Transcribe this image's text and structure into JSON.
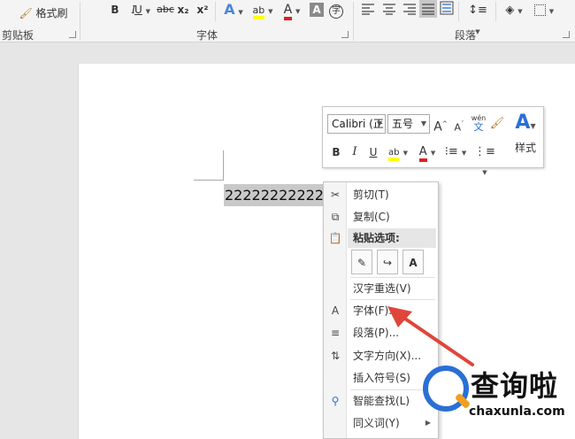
{
  "ribbon": {
    "clipboard": {
      "format_painter_label": "格式刷",
      "group_label": "剪贴板"
    },
    "font": {
      "bold": "B",
      "italic": "I",
      "underline": "U",
      "strikethrough": "abc",
      "subscript": "x₂",
      "superscript": "x²",
      "text_effect": "A",
      "highlight": "ab",
      "font_color": "A",
      "char_shading": "A",
      "enclose": "字",
      "group_label": "字体"
    },
    "paragraph": {
      "group_label": "段落"
    }
  },
  "document": {
    "selected_text": "2222222222222"
  },
  "mini_toolbar": {
    "font_name": "Calibri (正",
    "font_size": "五号",
    "grow": "A",
    "shrink": "A",
    "phonetic_top": "wén",
    "phonetic_bottom": "文",
    "styles_label": "样式",
    "bold": "B",
    "italic": "I",
    "underline": "U",
    "highlight": "ab",
    "font_color": "A"
  },
  "context_menu": {
    "cut": "剪切(T)",
    "copy": "复制(C)",
    "paste_options": "粘贴选项:",
    "hanzi_reselect": "汉字重选(V)",
    "font": "字体(F)...",
    "paragraph": "段落(P)...",
    "text_direction": "文字方向(X)...",
    "insert_symbol": "插入符号(S)",
    "smart_lookup": "智能查找(L)",
    "synonyms": "同义词(Y)"
  },
  "watermark": {
    "title": "查询啦",
    "url": "chaxunla.com"
  },
  "colors": {
    "highlight_yellow": "#ffff00",
    "font_red": "#e02020",
    "accent_blue": "#2a6fd6",
    "arrow_red": "#e0453a"
  }
}
